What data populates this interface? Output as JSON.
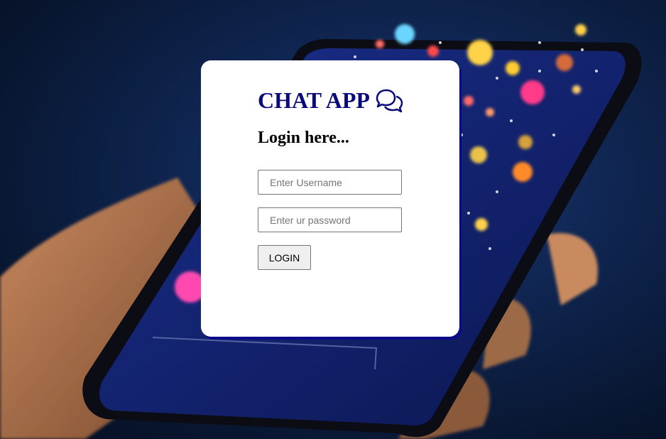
{
  "app": {
    "title": "CHAT APP",
    "title_icon": "chat-bubbles-icon"
  },
  "login": {
    "heading": "Login here...",
    "username_placeholder": "Enter Username",
    "password_placeholder": "Enter ur password",
    "button_label": "LOGIN"
  },
  "colors": {
    "title": "#0a0a7a",
    "card": "#ffffff",
    "card_shadow": "#0a0a8a",
    "background": "#0f2550"
  }
}
